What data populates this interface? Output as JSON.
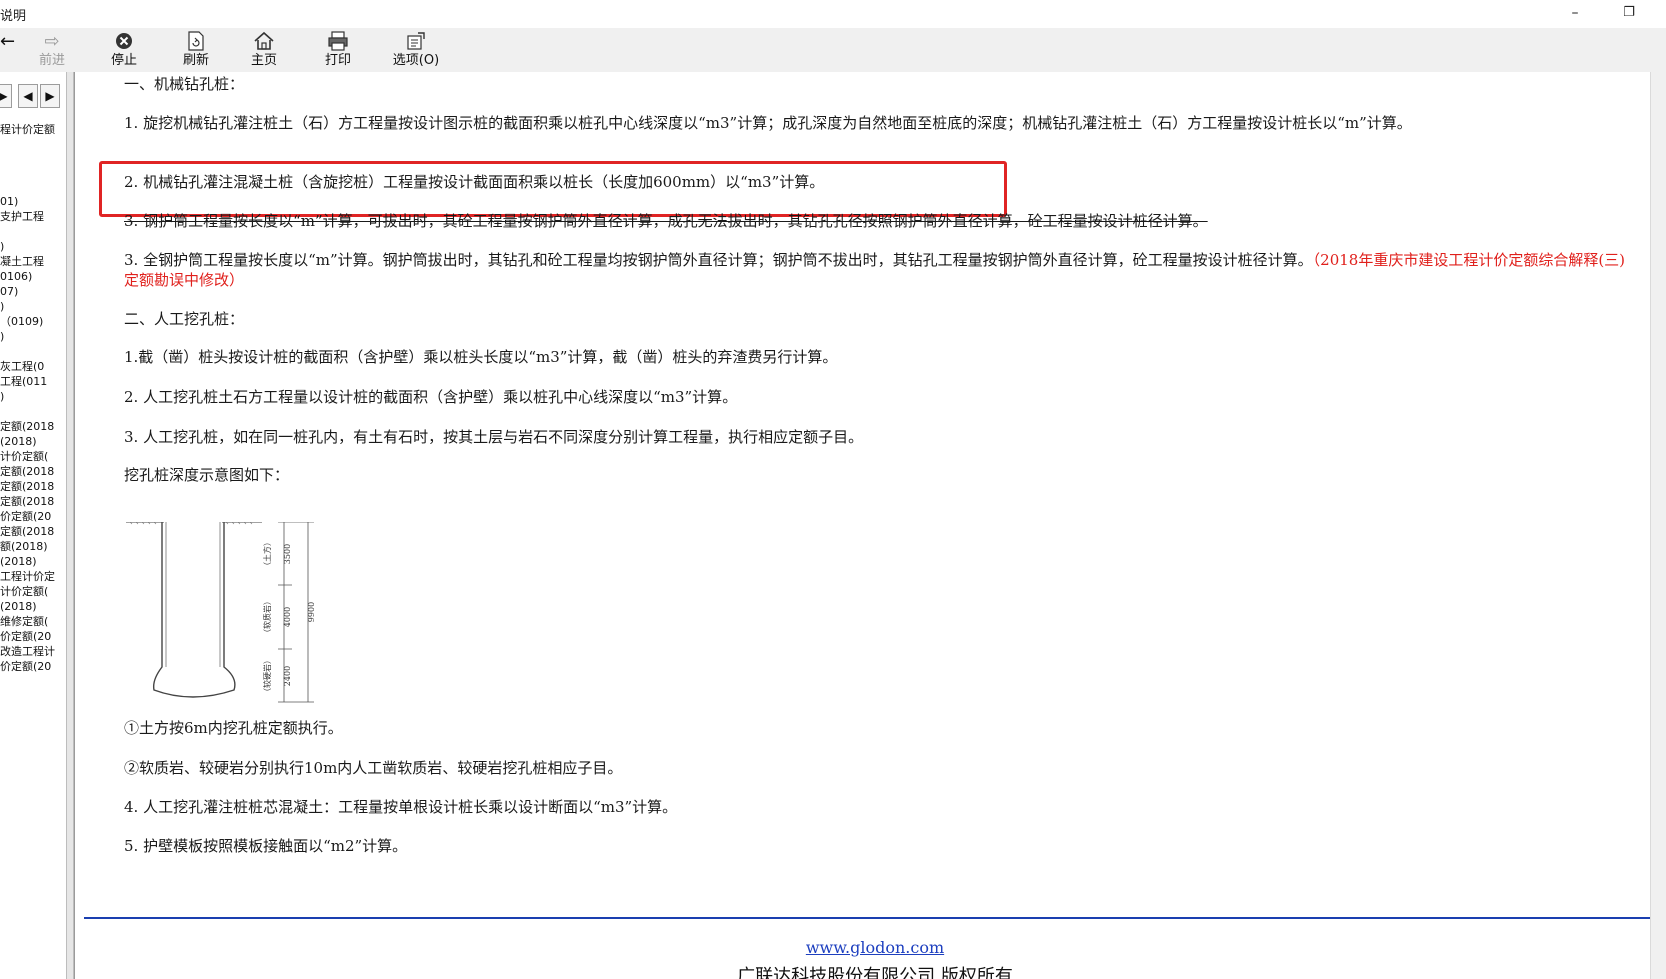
{
  "window": {
    "title": "说明",
    "minimize_glyph": "–",
    "maximize_glyph": "❐"
  },
  "toolbar": {
    "partial_left": "←",
    "forward_label": "前进",
    "stop_label": "停止",
    "refresh_label": "刷新",
    "home_label": "主页",
    "print_label": "打印",
    "options_label": "选项(O)"
  },
  "left_pane": {
    "nav": [
      "▶",
      "◀",
      "▶"
    ],
    "tree_items": [
      "程计价定额",
      "",
      "",
      "",
      "01)",
      "支护工程",
      "",
      ")",
      "凝土工程",
      "0106)",
      "07)",
      ")",
      "（0109)",
      ")",
      "",
      "灰工程(0",
      "工程(011",
      ")",
      "",
      "定额(2018",
      "(2018)",
      "计价定额(",
      "定额(2018",
      "定额(2018",
      "定额(2018",
      "价定额(20",
      "定额(2018",
      "额(2018)",
      "(2018)",
      "工程计价定",
      "计价定额(",
      "(2018)",
      "维修定额(",
      "价定额(20",
      "改造工程计",
      "价定额(20"
    ]
  },
  "content": {
    "section1_title": "一、机械钻孔桩：",
    "p1": "1. 旋挖机械钻孔灌注桩土（石）方工程量按设计图示桩的截面积乘以桩孔中心线深度以“m3”计算；成孔深度为自然地面至桩底的深度；机械钻孔灌注桩土（石）方工程量按设计桩长以“m”计算。",
    "p2": "2. 机械钻孔灌注混凝土桩（含旋挖桩）工程量按设计截面面积乘以桩长（长度加600mm）以“m3”计算。",
    "p3_struck": "3. 钢护筒工程量按长度以“m”计算，可拔出时，其砼工程量按钢护筒外直径计算，成孔无法拔出时，其钻孔孔径按照钢护筒外直径计算，砼工程量按设计桩径计算。",
    "p3_new": "3. 全钢护筒工程量按长度以“m”计算。钢护筒拔出时，其钻孔和砼工程量均按钢护筒外直径计算；钢护筒不拔出时，其钻孔工程量按钢护筒外直径计算，砼工程量按设计桩径计算。",
    "p3_note": "（2018年重庆市建设工程计价定额综合解释(三)定额勘误中修改）",
    "section2_title": "二、人工挖孔桩：",
    "q1": "1.截（凿）桩头按设计桩的截面积（含护壁）乘以桩头长度以“m3”计算，截（凿）桩头的弃渣费另行计算。",
    "q2": "2. 人工挖孔桩土石方工程量以设计桩的截面积（含护壁）乘以桩孔中心线深度以“m3”计算。",
    "q3": "3. 人工挖孔桩，如在同一桩孔内，有土有石时，按其土层与岩石不同深度分别计算工程量，执行相应定额子目。",
    "diagram_caption": "挖孔桩深度示意图如下：",
    "diagram": {
      "layer1_label": "（土方）",
      "layer1_value": "3500",
      "layer2_label": "（软质岩）",
      "layer2_value": "4000",
      "layer3_label": "（较硬岩）",
      "layer3_value": "2400",
      "total_value": "9900"
    },
    "n1": "①土方按6m内挖孔桩定额执行。",
    "n2": "②软质岩、较硬岩分别执行10m内人工凿软质岩、较硬岩挖孔桩相应子目。",
    "q4": "4. 人工挖孔灌注桩桩芯混凝土：工程量按单根设计桩长乘以设计断面以“m3”计算。",
    "q5": "5. 护壁模板按照模板接触面以“m2”计算。"
  },
  "footer": {
    "link": "www.glodon.com",
    "copyright": "广联达科技股份有限公司 版权所有"
  },
  "colors": {
    "highlight_box": "#e02424",
    "note_red": "#e0201c",
    "divider_blue": "#1a3fb0",
    "link_blue": "#1d3fbf"
  }
}
